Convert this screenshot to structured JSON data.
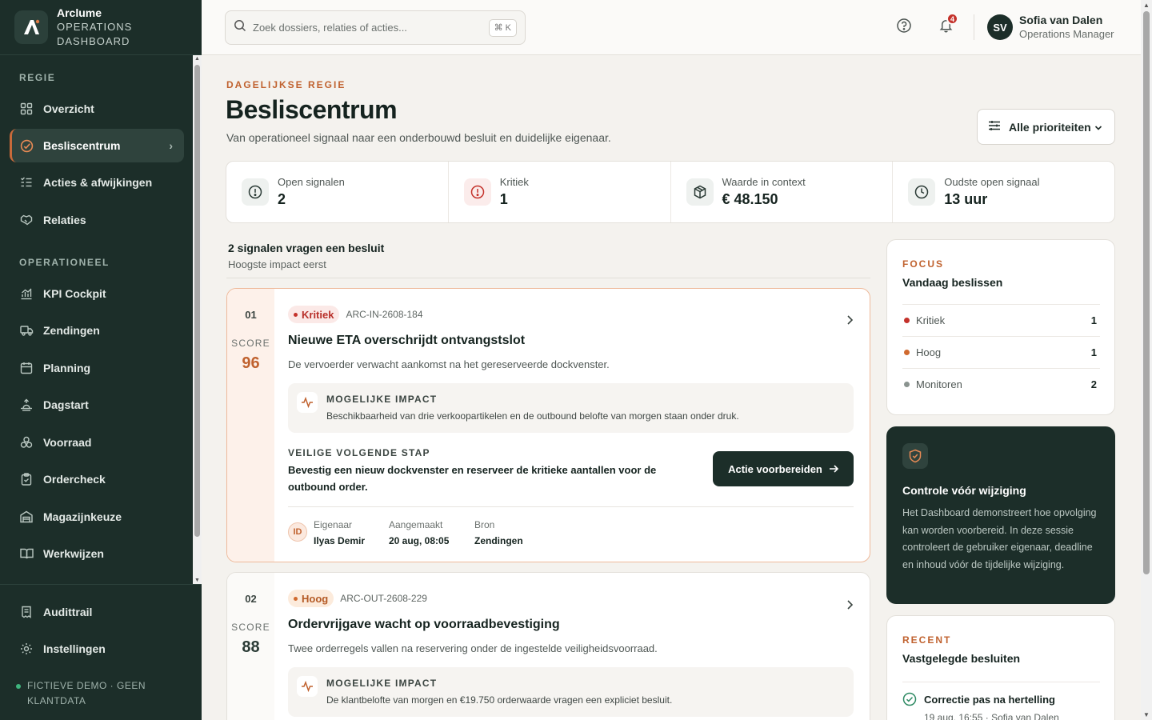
{
  "brand": {
    "name": "Arclume",
    "sub": "OPERATIONS DASHBOARD"
  },
  "sidebar": {
    "section_regie": "REGIE",
    "section_operationeel": "OPERATIONEEL",
    "items": [
      {
        "label": "Overzicht",
        "icon": "grid-icon"
      },
      {
        "label": "Besliscentrum",
        "icon": "target-icon",
        "active": true
      },
      {
        "label": "Acties & afwijkingen",
        "icon": "checklist-icon"
      },
      {
        "label": "Relaties",
        "icon": "handshake-icon"
      },
      {
        "label": "KPI Cockpit",
        "icon": "chart-icon"
      },
      {
        "label": "Zendingen",
        "icon": "truck-icon"
      },
      {
        "label": "Planning",
        "icon": "calendar-icon"
      },
      {
        "label": "Dagstart",
        "icon": "sunrise-icon"
      },
      {
        "label": "Voorraad",
        "icon": "boxes-icon"
      },
      {
        "label": "Ordercheck",
        "icon": "clipboard-icon"
      },
      {
        "label": "Magazijnkeuze",
        "icon": "warehouse-icon"
      },
      {
        "label": "Werkwijzen",
        "icon": "book-icon"
      }
    ],
    "bottom": [
      {
        "label": "Audittrail",
        "icon": "receipt-icon"
      },
      {
        "label": "Instellingen",
        "icon": "gear-icon"
      }
    ],
    "demo_note": "FICTIEVE DEMO · GEEN KLANTDATA"
  },
  "topbar": {
    "search_placeholder": "Zoek dossiers, relaties of acties...",
    "shortcut": "⌘ K",
    "notifications": "4",
    "user": {
      "initials": "SV",
      "name": "Sofia van Dalen",
      "role": "Operations Manager"
    }
  },
  "page": {
    "eyebrow": "DAGELIJKSE REGIE",
    "title": "Besliscentrum",
    "subtitle": "Van operationeel signaal naar een onderbouwd besluit en duidelijke eigenaar.",
    "priority_filter": "Alle prioriteiten"
  },
  "kpis": [
    {
      "label": "Open signalen",
      "value": "2",
      "icon": "alert-circle-icon"
    },
    {
      "label": "Kritiek",
      "value": "1",
      "icon": "alert-circle-icon"
    },
    {
      "label": "Waarde in context",
      "value": "€ 48.150",
      "icon": "package-icon"
    },
    {
      "label": "Oudste open signaal",
      "value": "13 uur",
      "icon": "clock-icon"
    }
  ],
  "list": {
    "heading": "2 signalen vragen een besluit",
    "subheading": "Hoogste impact eerst"
  },
  "signals": [
    {
      "num": "01",
      "score_label": "SCORE",
      "score": "96",
      "priority": "Kritiek",
      "ref": "ARC-IN-2608-184",
      "title": "Nieuwe ETA overschrijdt ontvangstslot",
      "desc": "De vervoerder verwacht aankomst na het gereserveerde dockvenster.",
      "impact_label": "MOGELIJKE IMPACT",
      "impact": "Beschikbaarheid van drie verkoopartikelen en de outbound belofte van morgen staan onder druk.",
      "step_label": "VEILIGE VOLGENDE STAP",
      "step": "Bevestig een nieuw dockvenster en reserveer de kritieke aantallen voor de outbound order.",
      "action": "Actie voorbereiden",
      "owner_initials": "ID",
      "owner_label": "Eigenaar",
      "owner": "Ilyas Demir",
      "created_label": "Aangemaakt",
      "created": "20 aug, 08:05",
      "source_label": "Bron",
      "source": "Zendingen"
    },
    {
      "num": "02",
      "score_label": "SCORE",
      "score": "88",
      "priority": "Hoog",
      "ref": "ARC-OUT-2608-229",
      "title": "Ordervrijgave wacht op voorraadbevestiging",
      "desc": "Twee orderregels vallen na reservering onder de ingestelde veiligheidsvoorraad.",
      "impact_label": "MOGELIJKE IMPACT",
      "impact": "De klantbelofte van morgen en €19.750 orderwaarde vragen een expliciet besluit."
    }
  ],
  "focus": {
    "eyebrow": "FOCUS",
    "title": "Vandaag beslissen",
    "rows": [
      {
        "label": "Kritiek",
        "value": "1",
        "color": "#c4322b"
      },
      {
        "label": "Hoog",
        "value": "1",
        "color": "#d06a2f"
      },
      {
        "label": "Monitoren",
        "value": "2",
        "color": "#8a938f"
      }
    ]
  },
  "control": {
    "title": "Controle vóór wijziging",
    "text": "Het Dashboard demonstreert hoe opvolging kan worden voorbereid. In deze sessie controleert de gebruiker eigenaar, deadline en inhoud vóór de tijdelijke wijziging."
  },
  "recent": {
    "eyebrow": "RECENT",
    "title": "Vastgelegde besluiten",
    "item_title": "Correctie pas na hertelling",
    "item_sub": "19 aug, 16:55 · Sofia van Dalen"
  }
}
